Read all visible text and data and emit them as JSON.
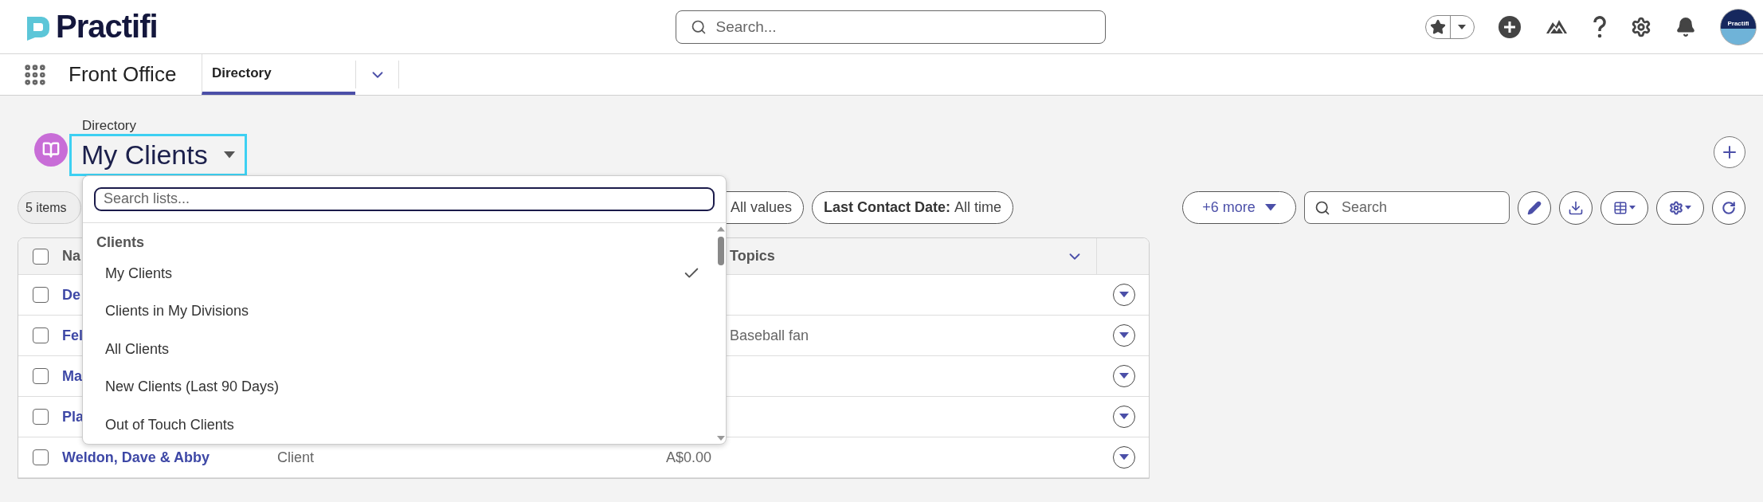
{
  "header": {
    "logo": "Practifi",
    "search": {
      "placeholder": "Search..."
    },
    "avatar": "Practifi"
  },
  "nav": {
    "app_name": "Front Office",
    "tabs": [
      {
        "label": "Directory",
        "selected": true
      }
    ]
  },
  "page": {
    "breadcrumb": "Directory",
    "title": "My Clients"
  },
  "filters": {
    "count": "5 items",
    "pills": [
      {
        "value": "All values"
      },
      {
        "label": "Last Contact Date:",
        "value": "All time"
      }
    ],
    "more": "+6 more",
    "search": {
      "placeholder": "Search"
    }
  },
  "table": {
    "select_all_checked": false,
    "columns": [
      {
        "kind": "name",
        "label": "Na"
      },
      {
        "kind": "topics",
        "label": "Topics"
      }
    ],
    "rows": [
      {
        "name": "De",
        "checked": false
      },
      {
        "name": "Fel",
        "topics": "Baseball fan",
        "checked": false
      },
      {
        "name": "Ma",
        "checked": false
      },
      {
        "name": "Pla",
        "checked": false
      },
      {
        "name": "Weldon, Dave & Abby",
        "type": "Client",
        "amount": "A$0.00",
        "checked": false
      }
    ]
  },
  "list_menu": {
    "search": {
      "placeholder": "Search lists..."
    },
    "group": "Clients",
    "items": [
      {
        "label": "My Clients",
        "selected": true
      },
      {
        "label": "Clients in My Divisions",
        "selected": false
      },
      {
        "label": "All Clients",
        "selected": false
      },
      {
        "label": "New Clients (Last 90 Days)",
        "selected": false
      },
      {
        "label": "Out of Touch Clients",
        "selected": false
      }
    ]
  }
}
